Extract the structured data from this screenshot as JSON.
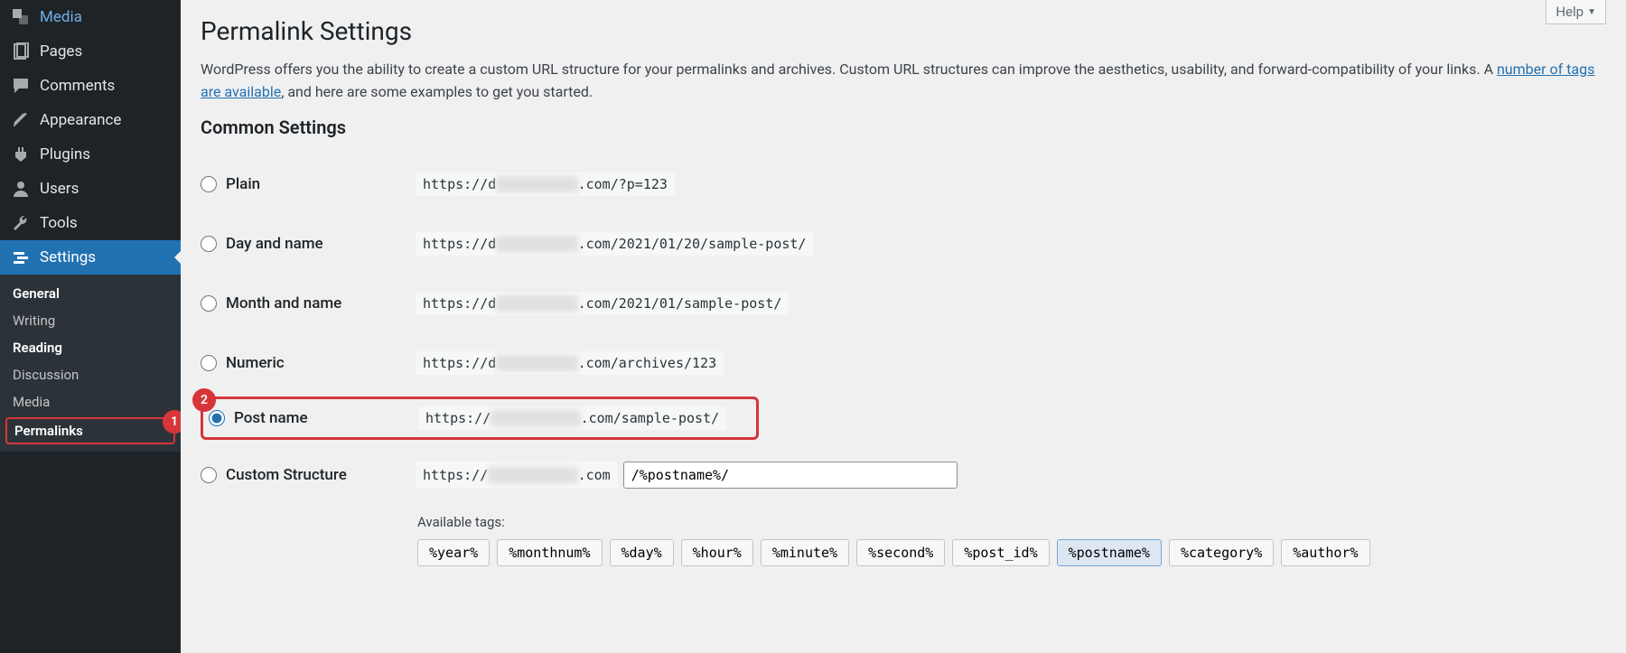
{
  "sidebar": {
    "items": [
      {
        "label": "Media"
      },
      {
        "label": "Pages"
      },
      {
        "label": "Comments"
      },
      {
        "label": "Appearance"
      },
      {
        "label": "Plugins"
      },
      {
        "label": "Users"
      },
      {
        "label": "Tools"
      },
      {
        "label": "Settings"
      }
    ],
    "sub": [
      {
        "label": "General"
      },
      {
        "label": "Writing"
      },
      {
        "label": "Reading"
      },
      {
        "label": "Discussion"
      },
      {
        "label": "Media"
      },
      {
        "label": "Permalinks"
      }
    ],
    "badge1": "1",
    "badge2": "2"
  },
  "header": {
    "help": "Help",
    "title": "Permalink Settings"
  },
  "intro": {
    "text1": "WordPress offers you the ability to create a custom URL structure for your permalinks and archives. Custom URL structures can improve the aesthetics, usability, and forward-compatibility of your links. A ",
    "link": "number of tags are available",
    "text2": ", and here are some examples to get you started."
  },
  "section": "Common Settings",
  "options": {
    "plain": {
      "label": "Plain",
      "prefix": "https://d",
      "blur": "██████████",
      "suffix": ".com/?p=123"
    },
    "dayname": {
      "label": "Day and name",
      "prefix": "https://d",
      "blur": "██████████",
      "suffix": ".com/2021/01/20/sample-post/"
    },
    "monthname": {
      "label": "Month and name",
      "prefix": "https://d",
      "blur": "██████████",
      "suffix": ".com/2021/01/sample-post/"
    },
    "numeric": {
      "label": "Numeric",
      "prefix": "https://d",
      "blur": "██████████",
      "suffix": ".com/archives/123"
    },
    "postname": {
      "label": "Post name",
      "prefix": "https://",
      "blur": "███████████",
      "suffix": ".com/sample-post/"
    },
    "custom": {
      "label": "Custom Structure",
      "prefix": "https://",
      "blur": "███████████",
      "suffix": ".com",
      "value": "/%postname%/"
    }
  },
  "avail_label": "Available tags:",
  "tags": [
    "%year%",
    "%monthnum%",
    "%day%",
    "%hour%",
    "%minute%",
    "%second%",
    "%post_id%",
    "%postname%",
    "%category%",
    "%author%"
  ],
  "active_tag_index": 7
}
